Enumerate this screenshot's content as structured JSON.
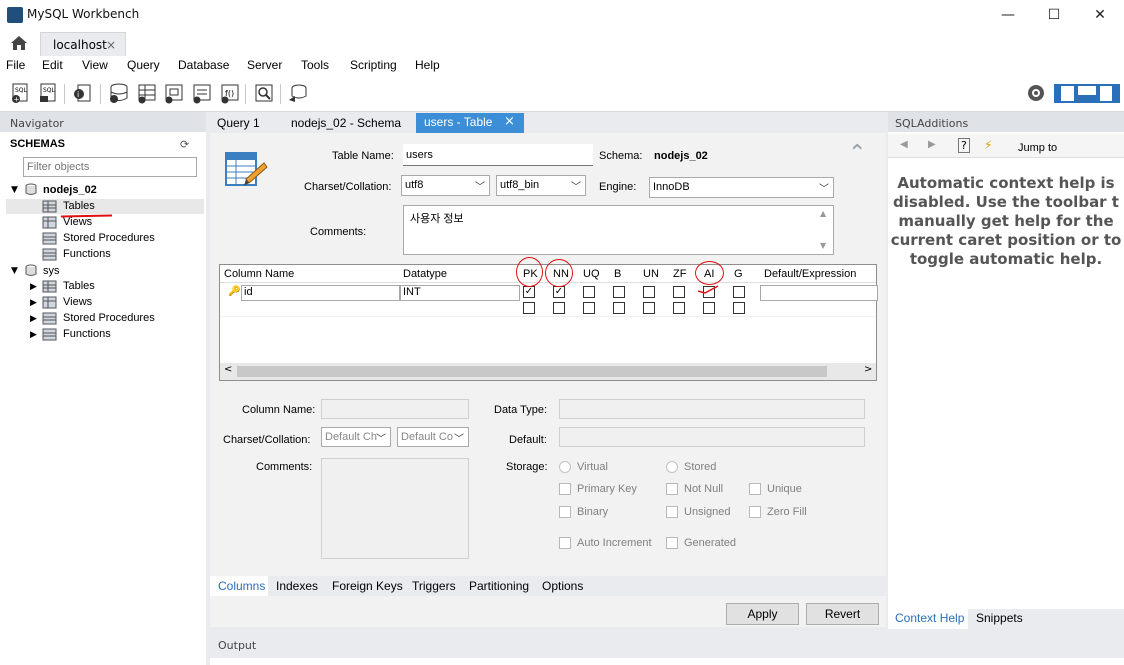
{
  "window": {
    "title": "MySQL Workbench",
    "minimize": "—",
    "maximize": "☐",
    "close": "✕"
  },
  "tabs": {
    "connection": "localhost",
    "close": "×"
  },
  "menu": [
    "File",
    "Edit",
    "View",
    "Query",
    "Database",
    "Server",
    "Tools",
    "Scripting",
    "Help"
  ],
  "navigator": {
    "header": "Navigator",
    "schemas_label": "SCHEMAS",
    "filter_placeholder": "Filter objects",
    "tree": [
      {
        "name": "nodejs_02",
        "children": [
          "Tables",
          "Views",
          "Stored Procedures",
          "Functions"
        ]
      },
      {
        "name": "sys",
        "children": [
          "Tables",
          "Views",
          "Stored Procedures",
          "Functions"
        ]
      }
    ]
  },
  "editor_tabs": [
    {
      "label": "Query 1"
    },
    {
      "label": "nodejs_02 - Schema"
    },
    {
      "label": "users - Table",
      "close": "×"
    }
  ],
  "table_form": {
    "table_name_label": "Table Name:",
    "table_name": "users",
    "schema_label": "Schema:",
    "schema": "nodejs_02",
    "charset_label": "Charset/Collation:",
    "charset": "utf8",
    "collation": "utf8_bin",
    "engine_label": "Engine:",
    "engine": "InnoDB",
    "comments_label": "Comments:",
    "comments": "사용자 정보"
  },
  "columns_grid": {
    "headers": [
      "Column Name",
      "Datatype",
      "PK",
      "NN",
      "UQ",
      "B",
      "UN",
      "ZF",
      "AI",
      "G",
      "Default/Expression"
    ],
    "rows": [
      {
        "name": "id",
        "datatype": "INT",
        "flags": [
          true,
          true,
          false,
          false,
          false,
          false,
          false,
          false
        ]
      }
    ]
  },
  "column_details": {
    "column_name_label": "Column Name:",
    "data_type_label": "Data Type:",
    "charset_label": "Charset/Collation:",
    "charset_default": "Default Ch",
    "collation_default": "Default Co",
    "default_label": "Default:",
    "comments_label": "Comments:",
    "storage_label": "Storage:",
    "storage_options": [
      "Virtual",
      "Stored"
    ],
    "checkboxes": [
      "Primary Key",
      "Not Null",
      "Unique",
      "Binary",
      "Unsigned",
      "Zero Fill",
      "Auto Increment",
      "Generated"
    ]
  },
  "bottom_tabs": [
    "Columns",
    "Indexes",
    "Foreign Keys",
    "Triggers",
    "Partitioning",
    "Options"
  ],
  "buttons": {
    "apply": "Apply",
    "revert": "Revert"
  },
  "sql_additions": {
    "header": "SQLAdditions",
    "jump_to": "Jump to",
    "help_text_lines": [
      "Automatic context help is",
      "disabled. Use the toolbar t",
      "manually get help for the",
      "current caret position or to",
      "toggle automatic help."
    ],
    "tabs": [
      "Context Help",
      "Snippets"
    ]
  },
  "output": {
    "header": "Output"
  },
  "colors": {
    "accent": "#3c8fd6",
    "annotation": "#e01010"
  }
}
